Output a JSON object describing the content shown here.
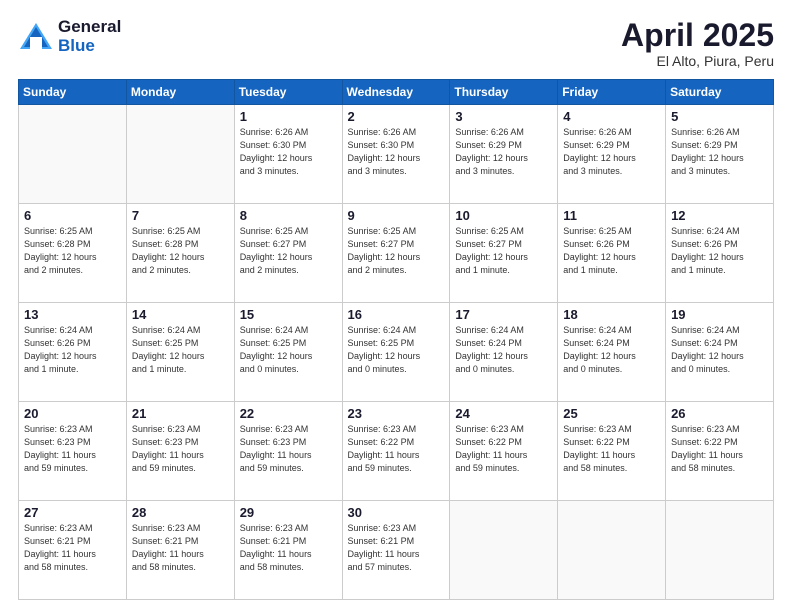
{
  "header": {
    "logo_general": "General",
    "logo_blue": "Blue",
    "title": "April 2025",
    "subtitle": "El Alto, Piura, Peru"
  },
  "weekdays": [
    "Sunday",
    "Monday",
    "Tuesday",
    "Wednesday",
    "Thursday",
    "Friday",
    "Saturday"
  ],
  "weeks": [
    [
      {
        "day": "",
        "info": ""
      },
      {
        "day": "",
        "info": ""
      },
      {
        "day": "1",
        "info": "Sunrise: 6:26 AM\nSunset: 6:30 PM\nDaylight: 12 hours\nand 3 minutes."
      },
      {
        "day": "2",
        "info": "Sunrise: 6:26 AM\nSunset: 6:30 PM\nDaylight: 12 hours\nand 3 minutes."
      },
      {
        "day": "3",
        "info": "Sunrise: 6:26 AM\nSunset: 6:29 PM\nDaylight: 12 hours\nand 3 minutes."
      },
      {
        "day": "4",
        "info": "Sunrise: 6:26 AM\nSunset: 6:29 PM\nDaylight: 12 hours\nand 3 minutes."
      },
      {
        "day": "5",
        "info": "Sunrise: 6:26 AM\nSunset: 6:29 PM\nDaylight: 12 hours\nand 3 minutes."
      }
    ],
    [
      {
        "day": "6",
        "info": "Sunrise: 6:25 AM\nSunset: 6:28 PM\nDaylight: 12 hours\nand 2 minutes."
      },
      {
        "day": "7",
        "info": "Sunrise: 6:25 AM\nSunset: 6:28 PM\nDaylight: 12 hours\nand 2 minutes."
      },
      {
        "day": "8",
        "info": "Sunrise: 6:25 AM\nSunset: 6:27 PM\nDaylight: 12 hours\nand 2 minutes."
      },
      {
        "day": "9",
        "info": "Sunrise: 6:25 AM\nSunset: 6:27 PM\nDaylight: 12 hours\nand 2 minutes."
      },
      {
        "day": "10",
        "info": "Sunrise: 6:25 AM\nSunset: 6:27 PM\nDaylight: 12 hours\nand 1 minute."
      },
      {
        "day": "11",
        "info": "Sunrise: 6:25 AM\nSunset: 6:26 PM\nDaylight: 12 hours\nand 1 minute."
      },
      {
        "day": "12",
        "info": "Sunrise: 6:24 AM\nSunset: 6:26 PM\nDaylight: 12 hours\nand 1 minute."
      }
    ],
    [
      {
        "day": "13",
        "info": "Sunrise: 6:24 AM\nSunset: 6:26 PM\nDaylight: 12 hours\nand 1 minute."
      },
      {
        "day": "14",
        "info": "Sunrise: 6:24 AM\nSunset: 6:25 PM\nDaylight: 12 hours\nand 1 minute."
      },
      {
        "day": "15",
        "info": "Sunrise: 6:24 AM\nSunset: 6:25 PM\nDaylight: 12 hours\nand 0 minutes."
      },
      {
        "day": "16",
        "info": "Sunrise: 6:24 AM\nSunset: 6:25 PM\nDaylight: 12 hours\nand 0 minutes."
      },
      {
        "day": "17",
        "info": "Sunrise: 6:24 AM\nSunset: 6:24 PM\nDaylight: 12 hours\nand 0 minutes."
      },
      {
        "day": "18",
        "info": "Sunrise: 6:24 AM\nSunset: 6:24 PM\nDaylight: 12 hours\nand 0 minutes."
      },
      {
        "day": "19",
        "info": "Sunrise: 6:24 AM\nSunset: 6:24 PM\nDaylight: 12 hours\nand 0 minutes."
      }
    ],
    [
      {
        "day": "20",
        "info": "Sunrise: 6:23 AM\nSunset: 6:23 PM\nDaylight: 11 hours\nand 59 minutes."
      },
      {
        "day": "21",
        "info": "Sunrise: 6:23 AM\nSunset: 6:23 PM\nDaylight: 11 hours\nand 59 minutes."
      },
      {
        "day": "22",
        "info": "Sunrise: 6:23 AM\nSunset: 6:23 PM\nDaylight: 11 hours\nand 59 minutes."
      },
      {
        "day": "23",
        "info": "Sunrise: 6:23 AM\nSunset: 6:22 PM\nDaylight: 11 hours\nand 59 minutes."
      },
      {
        "day": "24",
        "info": "Sunrise: 6:23 AM\nSunset: 6:22 PM\nDaylight: 11 hours\nand 59 minutes."
      },
      {
        "day": "25",
        "info": "Sunrise: 6:23 AM\nSunset: 6:22 PM\nDaylight: 11 hours\nand 58 minutes."
      },
      {
        "day": "26",
        "info": "Sunrise: 6:23 AM\nSunset: 6:22 PM\nDaylight: 11 hours\nand 58 minutes."
      }
    ],
    [
      {
        "day": "27",
        "info": "Sunrise: 6:23 AM\nSunset: 6:21 PM\nDaylight: 11 hours\nand 58 minutes."
      },
      {
        "day": "28",
        "info": "Sunrise: 6:23 AM\nSunset: 6:21 PM\nDaylight: 11 hours\nand 58 minutes."
      },
      {
        "day": "29",
        "info": "Sunrise: 6:23 AM\nSunset: 6:21 PM\nDaylight: 11 hours\nand 58 minutes."
      },
      {
        "day": "30",
        "info": "Sunrise: 6:23 AM\nSunset: 6:21 PM\nDaylight: 11 hours\nand 57 minutes."
      },
      {
        "day": "",
        "info": ""
      },
      {
        "day": "",
        "info": ""
      },
      {
        "day": "",
        "info": ""
      }
    ]
  ]
}
